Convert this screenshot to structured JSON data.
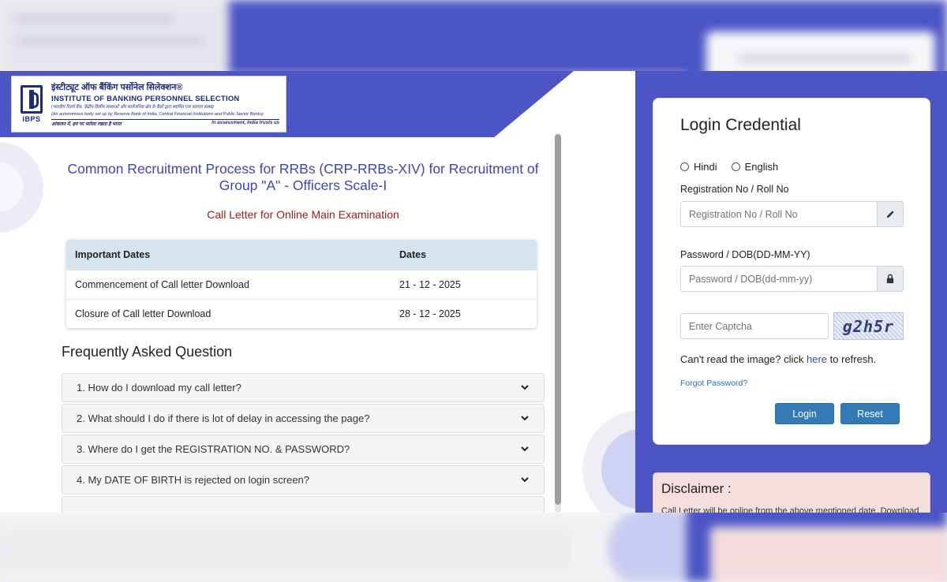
{
  "logo": {
    "hindi_name": "इंस्टीट्यूट ऑफ बैंकिंग पर्सोनेल सिलेक्शन®",
    "english_name": "INSTITUTE OF BANKING PERSONNEL SELECTION",
    "hindi_subtitle": "(भारतीय रिज़र्व बैंक, केंद्रीय वित्तीय संस्थाओं और सार्वजनिक क्षेत्र के बैंकों द्वारा स्थापित एक स्वायत्त संस्था)",
    "english_subtitle": "(An autonomous body set up by Reserve Bank of India, Central Financial Institutions and Public Sector Banks)",
    "tagline_hindi": "आंकलन में, हम पर भरोसा रखता है भारत",
    "tagline_english": "In assessment, India trusts us",
    "abbr": "IBPS"
  },
  "main": {
    "title": "Common Recruitment Process for RRBs (CRP-RRBs-XIV) for Recruitment of Group \"A\" - Officers Scale-I",
    "subtitle": "Call Letter for Online Main Examination",
    "dates_table": {
      "headers": [
        "Important Dates",
        "Dates"
      ],
      "rows": [
        [
          "Commencement of Call letter Download",
          "21 - 12 - 2025"
        ],
        [
          "Closure of Call letter Download",
          "28 - 12 - 2025"
        ]
      ]
    },
    "faq_title": "Frequently Asked Question",
    "faq": [
      "1. How do I download my call letter?",
      "2. What should I do if there is lot of delay in accessing the page?",
      "3. Where do I get the REGISTRATION NO. & PASSWORD?",
      "4. My DATE OF BIRTH is rejected on login screen?"
    ]
  },
  "login": {
    "title": "Login Credential",
    "lang_hindi": "Hindi",
    "lang_english": "English",
    "reg_label": "Registration No / Roll No",
    "reg_placeholder": "Registration No / Roll No",
    "pwd_label": "Password / DOB(DD-MM-YY)",
    "pwd_placeholder": "Password / DOB(dd-mm-yy)",
    "captcha_placeholder": "Enter Captcha",
    "captcha_text": "g2h5r",
    "refresh_prefix": "Can't read the image? click ",
    "refresh_link": "here",
    "refresh_suffix": " to refresh.",
    "forgot": "Forgot Password?",
    "login_btn": "Login",
    "reset_btn": "Reset"
  },
  "disclaimer": {
    "title": "Disclaimer :",
    "text": "Call Letter will be online from the above mentioned date. Download"
  },
  "colors": {
    "brand_blue": "#4b55c4",
    "title_blue": "#3c47b0",
    "subtitle_red": "#9a1b1b",
    "button_blue": "#337ab7"
  }
}
